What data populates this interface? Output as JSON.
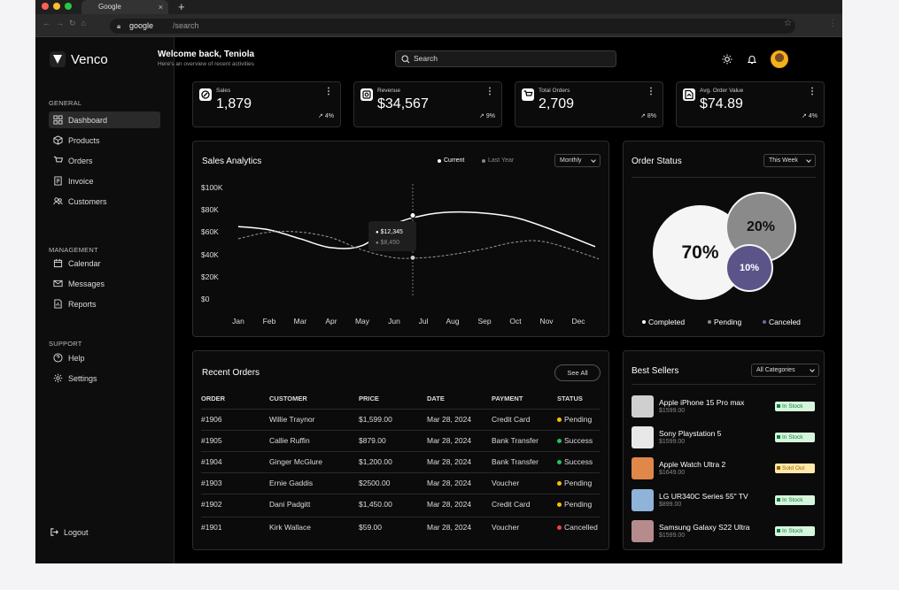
{
  "browser": {
    "tab_title": "Google",
    "tab_close": "×",
    "new_tab": "+",
    "url_host": "google",
    "url_path": "/search"
  },
  "app": {
    "name": "Venco"
  },
  "sidebar": {
    "general_label": "GENERAL",
    "management_label": "MANAGEMENT",
    "support_label": "SUPPORT",
    "general_items": [
      {
        "label": "Dashboard",
        "icon": "grid-icon"
      },
      {
        "label": "Products",
        "icon": "box-icon"
      },
      {
        "label": "Orders",
        "icon": "cart-icon"
      },
      {
        "label": "Invoice",
        "icon": "invoice-icon"
      },
      {
        "label": "Customers",
        "icon": "users-icon"
      }
    ],
    "management_items": [
      {
        "label": "Calendar",
        "icon": "calendar-icon"
      },
      {
        "label": "Messages",
        "icon": "mail-icon"
      },
      {
        "label": "Reports",
        "icon": "report-icon"
      }
    ],
    "support_items": [
      {
        "label": "Help",
        "icon": "help-icon"
      },
      {
        "label": "Settings",
        "icon": "gear-icon"
      }
    ],
    "logout": "Logout"
  },
  "header": {
    "welcome": "Welcome back, Teniola",
    "subtitle": "Here's an overview of recent activities",
    "search_placeholder": "Search"
  },
  "stats": [
    {
      "label": "Sales",
      "value": "1,879",
      "change": "4%"
    },
    {
      "label": "Revenue",
      "value": "$34,567",
      "change": "9%"
    },
    {
      "label": "Total Orders",
      "value": "2,709",
      "change": "8%"
    },
    {
      "label": "Avg. Order Value",
      "value": "$74.89",
      "change": "4%"
    }
  ],
  "sales_analytics": {
    "title": "Sales Analytics",
    "legend_current": "Current",
    "legend_last": "Last Year",
    "period": "Monthly",
    "tooltip_current": "$12,345",
    "tooltip_last": "$8,450"
  },
  "chart_data": {
    "type": "line",
    "x": [
      "Jan",
      "Feb",
      "Mar",
      "Apr",
      "May",
      "Jun",
      "Jul",
      "Aug",
      "Sep",
      "Oct",
      "Nov",
      "Dec"
    ],
    "yticks": [
      "$100K",
      "$80K",
      "$60K",
      "$40K",
      "$20K",
      "$0"
    ],
    "ylim": [
      0,
      100000
    ],
    "series": [
      {
        "name": "Current",
        "values": [
          65000,
          62000,
          54000,
          46000,
          48000,
          67000,
          75000,
          78000,
          77000,
          73000,
          64000,
          47000
        ]
      },
      {
        "name": "Last Year",
        "values": [
          54000,
          60000,
          60000,
          55000,
          44000,
          37000,
          37000,
          40000,
          45000,
          51000,
          51000,
          36000
        ]
      }
    ],
    "colors": {
      "current": "#ffffff",
      "last": "#9a9a9a"
    }
  },
  "order_status": {
    "title": "Order Status",
    "period": "This Week",
    "slices": [
      {
        "label": "Completed",
        "value": 70,
        "text": "70%",
        "color": "#f5f5f5"
      },
      {
        "label": "Pending",
        "value": 20,
        "text": "20%",
        "color": "#8a8a8a"
      },
      {
        "label": "Canceled",
        "value": 10,
        "text": "10%",
        "color": "#5a5489"
      }
    ]
  },
  "recent_orders": {
    "title": "Recent Orders",
    "see_all": "See All",
    "headers": [
      "ORDER",
      "CUSTOMER",
      "PRICE",
      "DATE",
      "PAYMENT",
      "STATUS"
    ],
    "rows": [
      {
        "order": "#1906",
        "customer": "Willie Traynor",
        "price": "$1,599.00",
        "date": "Mar 28, 2024",
        "payment": "Credit Card",
        "status": "Pending",
        "color": "#f2c200"
      },
      {
        "order": "#1905",
        "customer": "Callie Ruffin",
        "price": "$879.00",
        "date": "Mar 28, 2024",
        "payment": "Bank Transfer",
        "status": "Success",
        "color": "#22c55e"
      },
      {
        "order": "#1904",
        "customer": "Ginger McGlure",
        "price": "$1,200.00",
        "date": "Mar 28, 2024",
        "payment": "Bank Transfer",
        "status": "Success",
        "color": "#22c55e"
      },
      {
        "order": "#1903",
        "customer": "Ernie Gaddis",
        "price": "$2500.00",
        "date": "Mar 28, 2024",
        "payment": "Voucher",
        "status": "Pending",
        "color": "#f2c200"
      },
      {
        "order": "#1902",
        "customer": "Dani Padgitt",
        "price": "$1,450.00",
        "date": "Mar 28, 2024",
        "payment": "Credit Card",
        "status": "Pending",
        "color": "#f2c200"
      },
      {
        "order": "#1901",
        "customer": "Kirk Wallace",
        "price": "$59.00",
        "date": "Mar 28, 2024",
        "payment": "Voucher",
        "status": "Cancelled",
        "color": "#ef4444"
      }
    ]
  },
  "best_sellers": {
    "title": "Best Sellers",
    "filter": "All Categories",
    "items": [
      {
        "name": "Apple iPhone 15 Pro max",
        "price": "$1599.00",
        "stock": "In Stock",
        "badge_bg": "#d6f5dd",
        "badge_fg": "#15803d",
        "thumb": "#cfcfcf"
      },
      {
        "name": "Sony Playstation 5",
        "price": "$1599.00",
        "stock": "In Stock",
        "badge_bg": "#d6f5dd",
        "badge_fg": "#15803d",
        "thumb": "#e8e8e8"
      },
      {
        "name": "Apple Watch Ultra 2",
        "price": "$1649.00",
        "stock": "Sold Out",
        "badge_bg": "#fde9a8",
        "badge_fg": "#a16207",
        "thumb": "#e0874a"
      },
      {
        "name": "LG UR340C Series 55\" TV",
        "price": "$899.00",
        "stock": "In Stock",
        "badge_bg": "#d6f5dd",
        "badge_fg": "#15803d",
        "thumb": "#8fb3d9"
      },
      {
        "name": "Samsung Galaxy S22 Ultra",
        "price": "$1599.00",
        "stock": "In Stock",
        "badge_bg": "#d6f5dd",
        "badge_fg": "#15803d",
        "thumb": "#b58b8b"
      }
    ]
  }
}
